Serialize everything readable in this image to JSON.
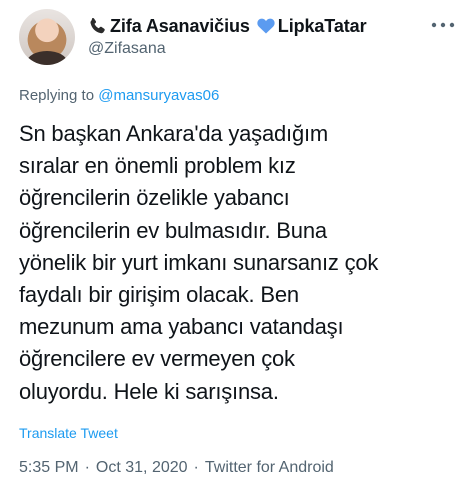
{
  "author": {
    "display_name": "Zifa Asanavičius",
    "name_suffix": "LipkaTatar",
    "handle": "@Zifasana"
  },
  "icons": {
    "phone": "telephone-receiver-icon",
    "heart": "blue-heart-icon",
    "more": "more-options-icon",
    "heart_color": "#5b9bf0",
    "phone_color": "#2b2b2b"
  },
  "reply": {
    "prefix": "Replying to ",
    "mention": "@mansuryavas06"
  },
  "tweet": {
    "text": "Sn başkan Ankara'da yaşadığım\nsıralar en önemli problem kız\nöğrencilerin özelikle yabancı\nöğrencilerin ev bulmasıdır. Buna\nyönelik bir yurt imkanı sunarsanız çok\nfaydalı bir girişim olacak. Ben\nmezunum ama yabancı vatandaşı\nöğrencilere ev vermeyen çok\noluyordu. Hele ki sarışınsa.",
    "translate_label": "Translate Tweet"
  },
  "meta": {
    "time": "5:35 PM",
    "date": "Oct 31, 2020",
    "source": "Twitter for Android",
    "separator": "·"
  },
  "colors": {
    "link": "#1d9bf0",
    "secondary_text": "#536471",
    "primary_text": "#0f1419"
  }
}
